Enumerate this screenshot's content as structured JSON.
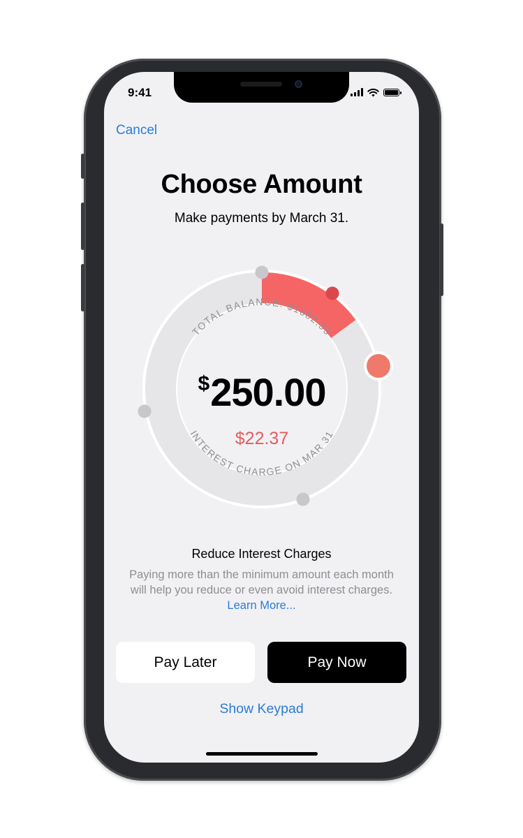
{
  "status_bar": {
    "time": "9:41"
  },
  "nav": {
    "cancel_label": "Cancel"
  },
  "header": {
    "title": "Choose Amount",
    "subtitle": "Make payments by March 31."
  },
  "dial": {
    "total_balance_label": "TOTAL BALANCE: $1682.55",
    "currency_symbol": "$",
    "amount": "250.00",
    "interest_amount": "$22.37",
    "interest_label": "INTEREST CHARGE ON MAR 31",
    "progress_fraction": 0.149,
    "accent_color": "#f66565"
  },
  "info": {
    "title": "Reduce Interest Charges",
    "body": "Paying more than the minimum amount each month will help you reduce or even avoid interest charges.",
    "learn_more_label": "Learn More..."
  },
  "actions": {
    "pay_later_label": "Pay Later",
    "pay_now_label": "Pay Now",
    "show_keypad_label": "Show Keypad"
  },
  "colors": {
    "link_blue": "#2a7bd8",
    "interest_red": "#e35d5d",
    "background": "#f1f1f4"
  },
  "icons": [
    "cellular-signal-icon",
    "wifi-icon",
    "battery-icon"
  ]
}
